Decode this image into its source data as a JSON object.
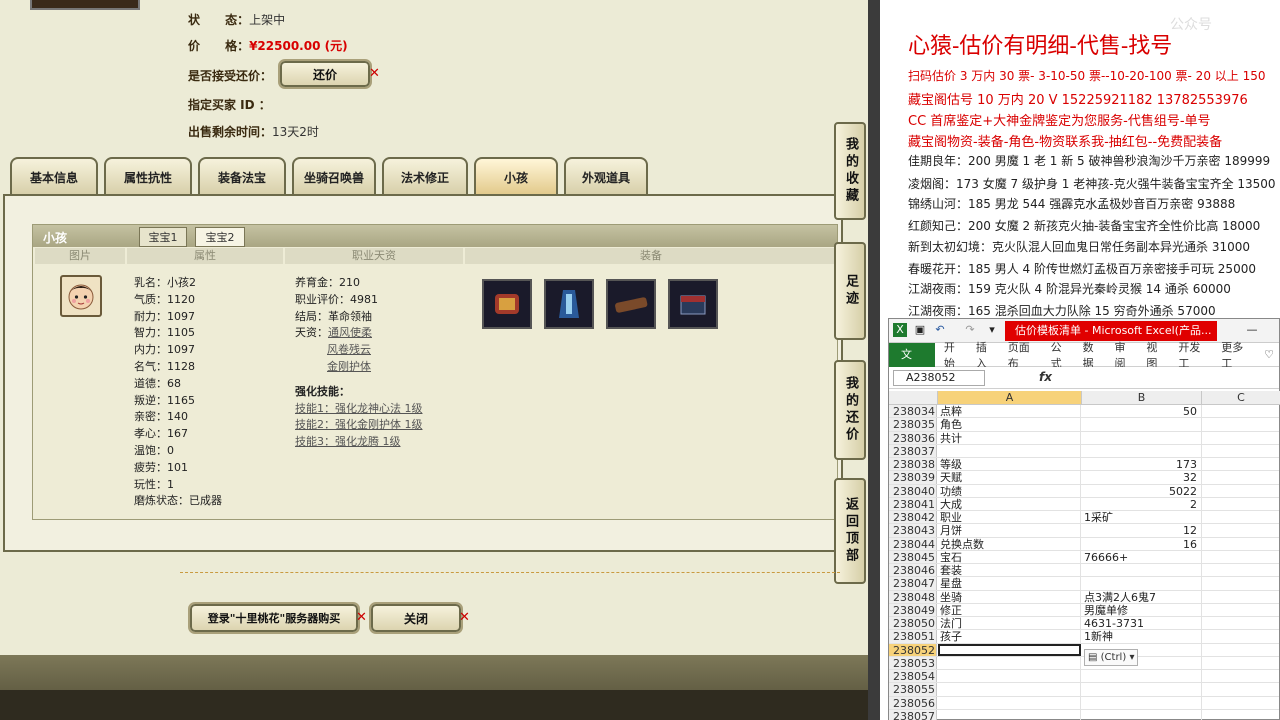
{
  "game": {
    "status_label": "状      态：",
    "status_value": "上架中",
    "price_label": "价      格：",
    "price_value": "¥22500.00 (元)",
    "accept_counter_label": "是否接受还价：",
    "counter_button": "还价",
    "buyer_label": "指定买家 ID ：",
    "time_label": "出售剩余时间：",
    "time_value": "13天2时",
    "tabs": [
      "基本信息",
      "属性抗性",
      "装备法宝",
      "坐骑召唤兽",
      "法术修正",
      "小孩",
      "外观道具"
    ],
    "active_tab": "小孩",
    "panel_title": "小孩",
    "subtabs": [
      "宝宝1",
      "宝宝2"
    ],
    "col_headers": [
      "图片",
      "属性",
      "职业天资",
      "装备"
    ],
    "attrs_left": [
      "乳名：小孩2",
      "气质：1120",
      "耐力：1097",
      "智力：1105",
      "内力：1097",
      "名气：1128",
      "道德：68",
      "叛逆：1165",
      "亲密：140",
      "孝心：167",
      "温饱：0",
      "疲劳：101",
      "玩性：1",
      "磨炼状态：已成器"
    ],
    "attrs_right": [
      "养育金：210",
      "职业评价：4981",
      "结局：革命领袖",
      "天资："
    ],
    "talents": [
      "通风使柔",
      "风卷残云",
      "金刚护体"
    ],
    "skill_header": "强化技能：",
    "skills": [
      "技能1：强化龙神心法 1级",
      "技能2：强化金刚护体 1级",
      "技能3：强化龙腾 1级"
    ],
    "side_buttons": [
      "我的收藏",
      "足迹",
      "我的还价",
      "返回顶部"
    ],
    "login_button": "登录\"十里桃花\"服务器购买",
    "close_button": "关闭"
  },
  "ad": {
    "title": "心猿-估价有明细-代售-找号",
    "watermark": "公众号",
    "lines": [
      {
        "text": "扫码估价 3 万内 30 票- 3-10-50 票--10-20-100 票- 20 以上 150",
        "color": "#d90000"
      },
      {
        "text": "藏宝阁估号 10 万内 20 V 15225921182   13782553976",
        "color": "#d90000"
      },
      {
        "text": "CC 首席鉴定+大神金牌鉴定为您服务-代售组号-单号",
        "color": "#d90000"
      },
      {
        "text": "藏宝阁物资-装备-角色-物资联系我-抽红包--免费配装备",
        "color": "#d90000"
      },
      {
        "text": "佳期良年：200 男魔 1 老 1 新 5 破神兽秒浪淘沙千万亲密 189999",
        "color": "#111111"
      },
      {
        "text": "凌烟阁：173 女魔 7 级护身 1 老神孩-克火强牛装备宝宝齐全 13500",
        "color": "#111111"
      },
      {
        "text": "锦绣山河：185 男龙 544 强霹克水孟极妙音百万亲密 93888",
        "color": "#111111"
      },
      {
        "text": "红颜知己：200 女魔 2 新孩克火抽-装备宝宝齐全性价比高 18000",
        "color": "#111111"
      },
      {
        "text": "新到太初幻境：克火队混人回血鬼日常任务副本异光通杀 31000",
        "color": "#111111"
      },
      {
        "text": "春暖花开：185 男人 4 阶传世燃灯孟极百万亲密接手可玩 25000",
        "color": "#111111"
      },
      {
        "text": "江湖夜雨：159 克火队 4 阶混异光秦岭灵猴 14 通杀 60000",
        "color": "#111111"
      },
      {
        "text": "江湖夜雨：165 混杀回血大力队除 15 穷奇外通杀 57000",
        "color": "#111111"
      }
    ]
  },
  "excel": {
    "window_title": "估价模板清单 - Microsoft Excel(产品...",
    "ribbon_tabs": [
      "文件",
      "开始",
      "插入",
      "页面布",
      "公式",
      "数据",
      "审阅",
      "视图",
      "开发工",
      "更多工"
    ],
    "name_box": "A238052",
    "fx_label": "fx",
    "col_headers": [
      "A",
      "B",
      "C"
    ],
    "rows": [
      {
        "n": "238034",
        "a": "点粹",
        "b": "50",
        "num": true
      },
      {
        "n": "238035",
        "a": "角色",
        "b": "",
        "num": false
      },
      {
        "n": "238036",
        "a": "共计",
        "b": "",
        "num": false
      },
      {
        "n": "238037",
        "a": "",
        "b": "",
        "num": false
      },
      {
        "n": "238038",
        "a": "等级",
        "b": "173",
        "num": true
      },
      {
        "n": "238039",
        "a": "天赋",
        "b": "32",
        "num": true
      },
      {
        "n": "238040",
        "a": "功绩",
        "b": "5022",
        "num": true
      },
      {
        "n": "238041",
        "a": "大成",
        "b": "2",
        "num": true
      },
      {
        "n": "238042",
        "a": "职业",
        "b": "1采矿",
        "num": false
      },
      {
        "n": "238043",
        "a": "月饼",
        "b": "12",
        "num": true
      },
      {
        "n": "238044",
        "a": "兑换点数",
        "b": "16",
        "num": true
      },
      {
        "n": "238045",
        "a": "宝石",
        "b": "76666+",
        "num": false
      },
      {
        "n": "238046",
        "a": "套装",
        "b": "",
        "num": false
      },
      {
        "n": "238047",
        "a": "星盘",
        "b": "",
        "num": false
      },
      {
        "n": "238048",
        "a": "坐骑",
        "b": "点3满2人6鬼7",
        "num": false
      },
      {
        "n": "238049",
        "a": "修正",
        "b": "男魔单修",
        "num": false
      },
      {
        "n": "238050",
        "a": "法门",
        "b": "4631-3731",
        "num": false
      },
      {
        "n": "238051",
        "a": "孩子",
        "b": "1新神",
        "num": false
      },
      {
        "n": "238052",
        "a": "",
        "b": "",
        "num": false
      },
      {
        "n": "238053",
        "a": "",
        "b": "",
        "num": false
      },
      {
        "n": "238054",
        "a": "",
        "b": "",
        "num": false
      },
      {
        "n": "238055",
        "a": "",
        "b": "",
        "num": false
      },
      {
        "n": "238056",
        "a": "",
        "b": "",
        "num": false
      },
      {
        "n": "238057",
        "a": "",
        "b": "",
        "num": false
      }
    ],
    "paste_options": "(Ctrl)",
    "selected_row": "238052"
  }
}
